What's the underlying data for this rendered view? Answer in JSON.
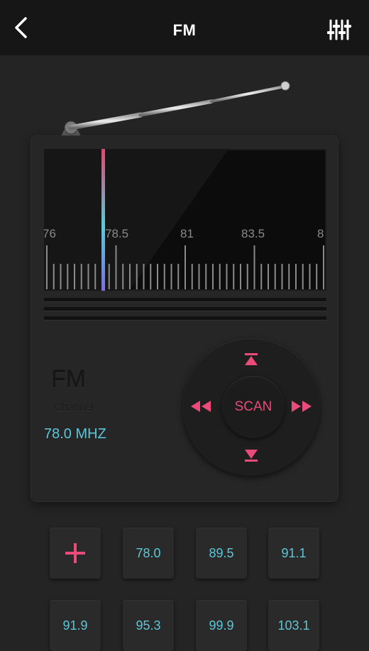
{
  "header": {
    "title": "FM",
    "back_icon": "chevron-left-icon",
    "equalizer_icon": "equalizer-icon"
  },
  "dial": {
    "scale_labels": [
      "76",
      "78.5",
      "81",
      "83.5",
      "8"
    ],
    "indicator_value_mhz": 78.0,
    "colors": {
      "indicator_top": "#f0406e",
      "indicator_bottom": "#7a6cf0",
      "indicator_mid": "#4dd0e1"
    }
  },
  "info": {
    "band": "FM",
    "channel_label": "Channel",
    "frequency": "78.0 MHZ"
  },
  "controls": {
    "scan_label": "SCAN",
    "up_icon": "skip-up-icon",
    "down_icon": "skip-down-icon",
    "prev_icon": "rewind-icon",
    "next_icon": "fast-forward-icon"
  },
  "presets": {
    "add_icon": "plus-icon",
    "items": [
      "78.0",
      "89.5",
      "91.1",
      "91.9",
      "95.3",
      "99.9",
      "103.1"
    ]
  },
  "colors": {
    "accent": "#ec4a7a",
    "frequency_text": "#5cc7d8",
    "background": "#242424",
    "header_bg": "#161616"
  }
}
